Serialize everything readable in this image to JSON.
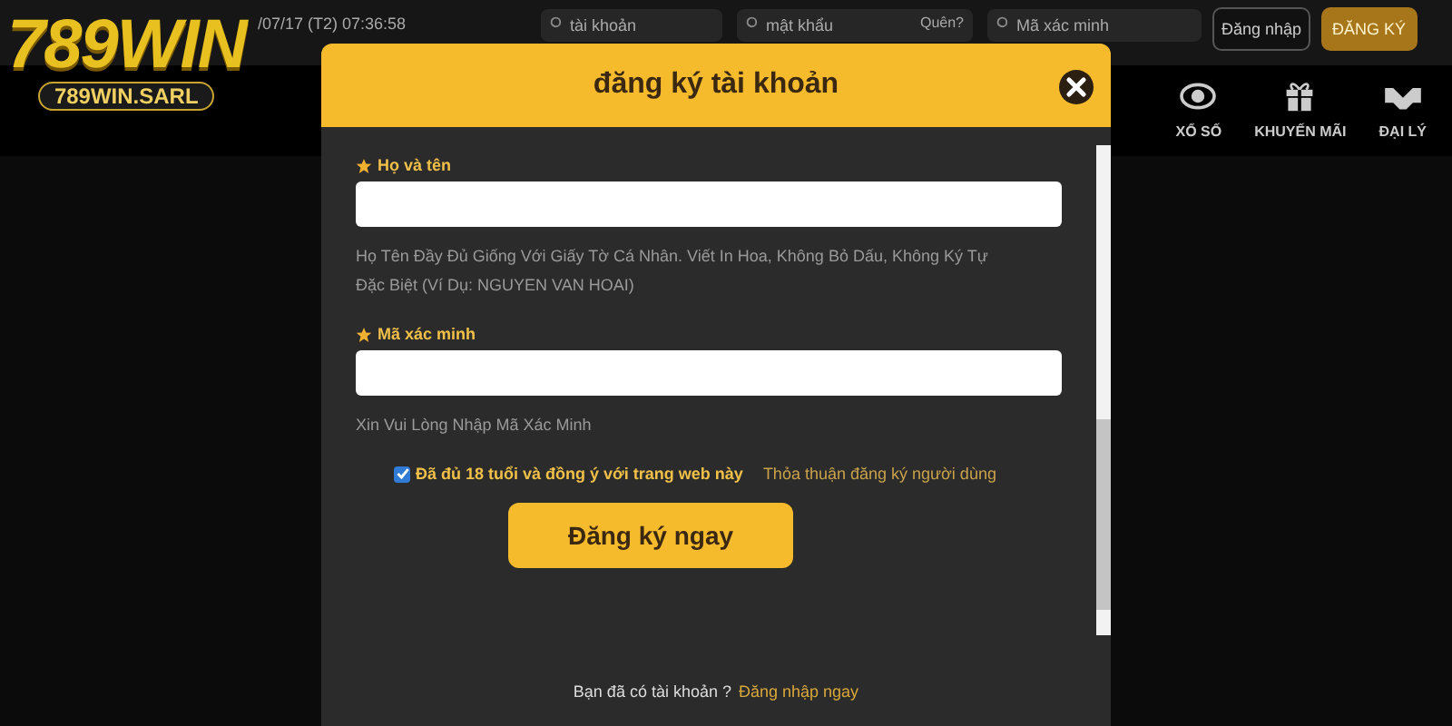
{
  "logo": {
    "brand": "789WIN",
    "domain": "789WIN.SARL"
  },
  "topbar": {
    "datetime": "/07/17 (T2) 07:36:58",
    "fields": [
      {
        "placeholder": "tài khoản"
      },
      {
        "placeholder": "mật khẩu",
        "hint": "Quên?"
      },
      {
        "placeholder": "Mã xác minh"
      }
    ],
    "login_button": "Đăng nhập",
    "register_button": "ĐĂNG KÝ"
  },
  "nav": [
    {
      "kind": "lottery",
      "label": "XỔ SỐ"
    },
    {
      "kind": "promo",
      "label": "KHUYẾN MÃI"
    },
    {
      "kind": "agent",
      "label": "ĐẠI LÝ"
    }
  ],
  "modal": {
    "title": "đăng ký tài khoản",
    "fields": [
      {
        "label": "Họ và tên",
        "help": "Họ Tên Đầy Đủ Giống Với Giấy Tờ Cá Nhân. Viết In Hoa, Không Bỏ Dấu, Không Ký Tự Đặc Biệt (Ví Dụ: NGUYEN VAN HOAI)"
      },
      {
        "label": "Mã xác minh",
        "help": "Xin Vui Lòng Nhập Mã Xác Minh"
      }
    ],
    "agree": {
      "checked": true,
      "text": "Đã đủ 18 tuổi và đồng ý với trang web này",
      "link": "Thỏa thuận đăng ký người dùng"
    },
    "submit": "Đăng ký ngay",
    "footer": {
      "text": "Bạn đã có tài khoản ?",
      "link": "Đăng nhập ngay"
    }
  }
}
